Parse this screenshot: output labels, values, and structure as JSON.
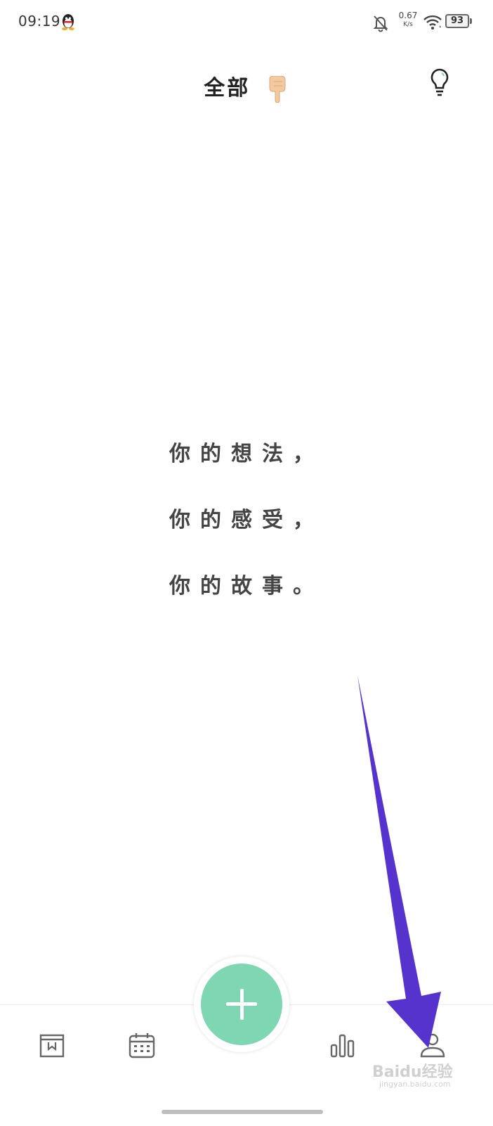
{
  "status_bar": {
    "time": "09:19",
    "net_speed_value": "0.67",
    "net_speed_unit": "K/s",
    "battery": "93",
    "icons": [
      "qq-penguin-icon",
      "bell-off-icon",
      "wifi-icon",
      "battery-icon"
    ]
  },
  "header": {
    "title": "全部",
    "title_icon": "pointing-down-hand-icon",
    "right_icon": "lightbulb-icon"
  },
  "empty_state": {
    "line1": "你的想法，",
    "line2": "你的感受，",
    "line3": "你的故事。"
  },
  "bottom_nav": {
    "items": [
      {
        "icon": "diary-book-icon"
      },
      {
        "icon": "calendar-icon"
      },
      {
        "icon": "add-icon"
      },
      {
        "icon": "bar-chart-icon"
      },
      {
        "icon": "profile-icon"
      }
    ],
    "fab_color": "#7fd6b3"
  },
  "annotation": {
    "arrow_color": "#5533cc",
    "watermark": "Baidu经验",
    "watermark_sub": "jingyan.baidu.com"
  }
}
